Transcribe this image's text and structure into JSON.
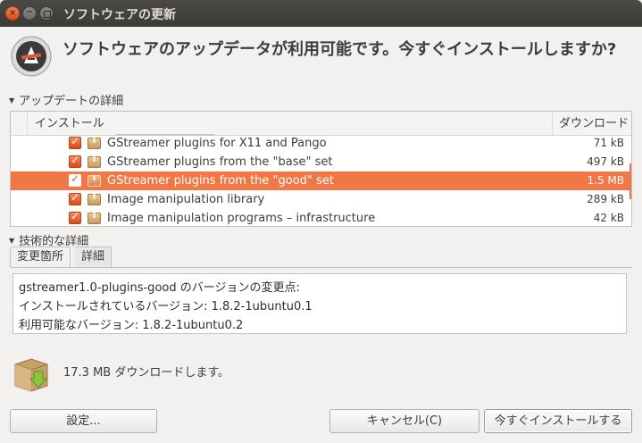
{
  "window": {
    "title": "ソフトウェアの更新",
    "close_glyph": "×",
    "min_glyph": "−"
  },
  "header": {
    "headline": "ソフトウェアのアップデータが利用可能です。今すぐインストールしますか?"
  },
  "update_details": {
    "expander_label": "アップデートの詳細",
    "columns": {
      "name": "インストール",
      "size": "ダウンロード"
    },
    "rows": [
      {
        "name": "GStreamer plugins for X11 and Pango",
        "size": "71 kB",
        "checked": true,
        "selected": false
      },
      {
        "name": "GStreamer plugins from the \"base\" set",
        "size": "497 kB",
        "checked": true,
        "selected": false
      },
      {
        "name": "GStreamer plugins from the \"good\" set",
        "size": "1.5 MB",
        "checked": true,
        "selected": true
      },
      {
        "name": "Image manipulation library",
        "size": "289 kB",
        "checked": true,
        "selected": false
      },
      {
        "name": "Image manipulation programs – infrastructure",
        "size": "42 kB",
        "checked": true,
        "selected": false
      }
    ]
  },
  "technical_details": {
    "expander_label": "技術的な詳細",
    "tabs": [
      {
        "label": "変更箇所",
        "active": true
      },
      {
        "label": "詳細",
        "active": false
      }
    ],
    "changes_lines": [
      "gstreamer1.0-plugins-good のバージョンの変更点:",
      "インストールされているバージョン: 1.8.2-1ubuntu0.1",
      "利用可能なバージョン: 1.8.2-1ubuntu0.2"
    ]
  },
  "summary": {
    "download_text": "17.3 MB ダウンロードします。"
  },
  "buttons": {
    "settings": "設定...",
    "cancel": "キャンセル(C)",
    "install": "今すぐインストールする"
  },
  "colors": {
    "accent": "#f07746",
    "titlebar": "#3c3b37",
    "background": "#f2f1f0"
  }
}
